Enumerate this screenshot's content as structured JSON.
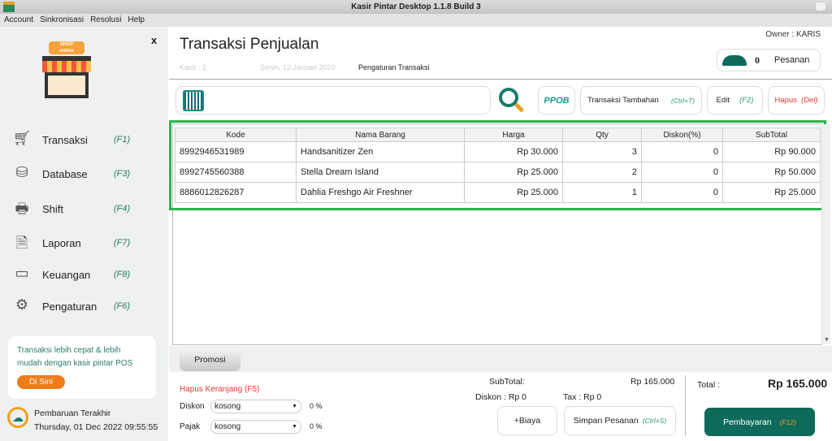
{
  "window": {
    "title": "Kasir Pintar Desktop 1.1.8  Build 3"
  },
  "menu": [
    "Account",
    "Sinkronisasi",
    "Resolusi",
    "Help"
  ],
  "sidebar": {
    "close": "x",
    "logo_text": "SHOP online",
    "items": [
      {
        "label": "Transaksi",
        "key": "(F1)",
        "icon": "cart-icon"
      },
      {
        "label": "Database",
        "key": "(F3)",
        "icon": "database-icon"
      },
      {
        "label": "Shift",
        "key": "(F4)",
        "icon": "cashier-icon"
      },
      {
        "label": "Laporan",
        "key": "(F7)",
        "icon": "report-icon"
      },
      {
        "label": "Keuangan",
        "key": "(F8)",
        "icon": "wallet-icon"
      },
      {
        "label": "Pengaturan",
        "key": "(F6)",
        "icon": "gear-icon"
      }
    ],
    "promo": {
      "text1": "Transaksi lebih cepat & lebih",
      "text2": "mudah dengan kasir pintar POS",
      "button": "Di Sini"
    },
    "update": {
      "label": "Pembaruan Terakhir",
      "time": "Thursday, 01 Dec 2022 09:55:55"
    }
  },
  "header": {
    "title": "Transaksi Penjualan",
    "kasir": "Kasir : 1",
    "date": "Senin, 13 Januari 2020",
    "settings": "Pengaturan Transaksi",
    "owner": "Owner : KARIS",
    "orders_count": "0",
    "orders_label": "Pesanan"
  },
  "toolbar": {
    "search_value": "",
    "ppob": "PPOB",
    "extra": "Transaksi Tambahan",
    "extra_key": "(Ctrl+T)",
    "edit": "Edit",
    "edit_key": "(F2)",
    "delete": "Hapus",
    "delete_key": "(Del)"
  },
  "table": {
    "headers": [
      "Kode",
      "Nama Barang",
      "Harga",
      "Qty",
      "Diskon(%)",
      "SubTotal"
    ],
    "rows": [
      [
        "8992946531989",
        "Handsanitizer Zen",
        "Rp 30.000",
        "3",
        "0",
        "Rp 90.000"
      ],
      [
        "8992745560388",
        "Stella Dream Island",
        "Rp 25.000",
        "2",
        "0",
        "Rp 50.000"
      ],
      [
        "8886012826287",
        "Dahlia Freshgo Air Freshner",
        "Rp 25.000",
        "1",
        "0",
        "Rp 25.000"
      ]
    ]
  },
  "footer": {
    "promo_tab": "Promosi",
    "clear_cart": "Hapus Keranjang (F5)",
    "diskon_label": "Diskon",
    "diskon_value": "kosong",
    "diskon_pct": "0 %",
    "pajak_label": "Pajak",
    "pajak_value": "kosong",
    "pajak_pct": "0 %",
    "subtotal_label": "SubTotal:",
    "subtotal": "Rp 165.000",
    "diskon_summary": "Diskon : Rp 0",
    "tax_summary": "Tax : Rp 0",
    "biaya": "+Biaya",
    "save": "Simpan Pesanan",
    "save_key": "(Ctrl+S)",
    "total_label": "Total :",
    "total": "Rp 165.000",
    "pay": "Pembayaran",
    "pay_key": "(F12)"
  },
  "colors": {
    "accent": "#0e6b5a",
    "highlight": "#2db34a",
    "danger": "#e53935",
    "orange": "#f07b1a"
  }
}
